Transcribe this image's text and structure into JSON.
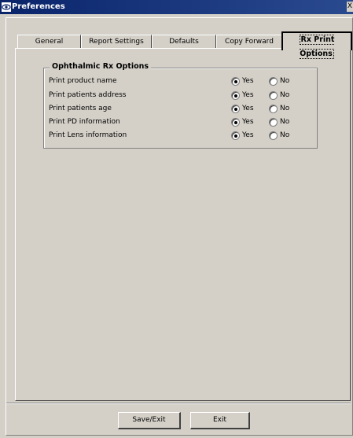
{
  "window": {
    "title": "Preferences",
    "close_glyph": "X"
  },
  "tabs": [
    {
      "label": "General"
    },
    {
      "label": "Report Settings"
    },
    {
      "label": "Defaults"
    },
    {
      "label": "Copy Forward"
    },
    {
      "label": "Rx Print Options",
      "active": true
    }
  ],
  "group": {
    "title": "Ophthalmic Rx Options",
    "rows": [
      {
        "label": "Print product name",
        "yes": "Yes",
        "no": "No",
        "selected": "Yes"
      },
      {
        "label": "Print patients address",
        "yes": "Yes",
        "no": "No",
        "selected": "Yes"
      },
      {
        "label": "Print patients age",
        "yes": "Yes",
        "no": "No",
        "selected": "Yes"
      },
      {
        "label": "Print PD information",
        "yes": "Yes",
        "no": "No",
        "selected": "Yes"
      },
      {
        "label": "Print Lens information",
        "yes": "Yes",
        "no": "No",
        "selected": "Yes"
      }
    ]
  },
  "buttons": {
    "save_exit": "Save/Exit",
    "exit": "Exit"
  }
}
